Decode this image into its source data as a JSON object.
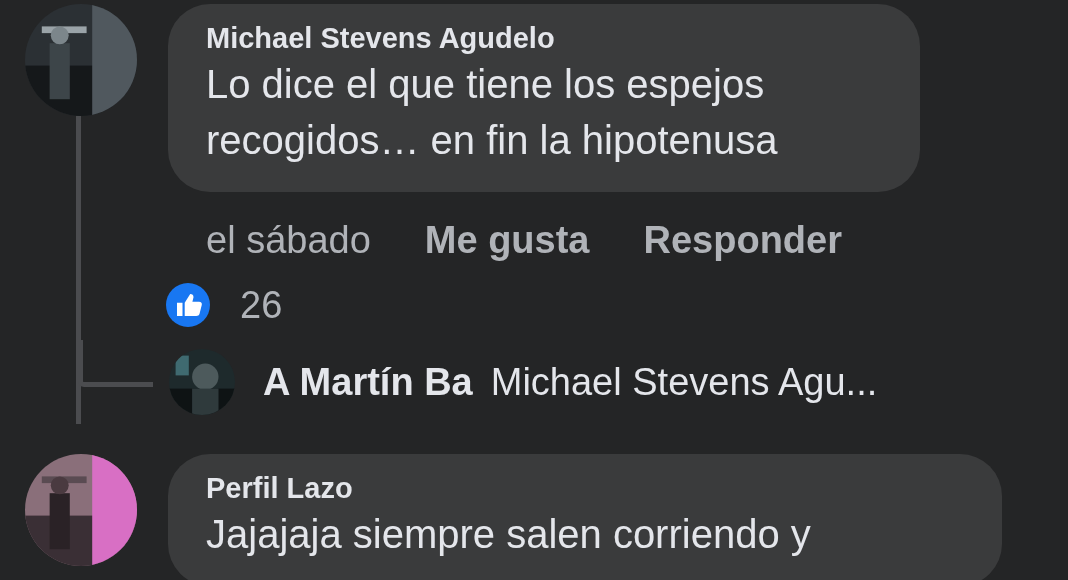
{
  "comments": [
    {
      "author": "Michael Stevens Agudelo",
      "text": "Lo dice el que tiene los espejos recogidos… en fin la hipotenusa",
      "time": "el sábado",
      "actions": [
        "Me gusta",
        "Responder"
      ],
      "reactions": {
        "count": "26"
      },
      "reply_preview": {
        "author": "A Martín Ba",
        "text": "Michael Stevens Agu..."
      }
    },
    {
      "author": "Perfil Lazo",
      "text": "Jajajaja siempre salen corriendo y"
    }
  ]
}
